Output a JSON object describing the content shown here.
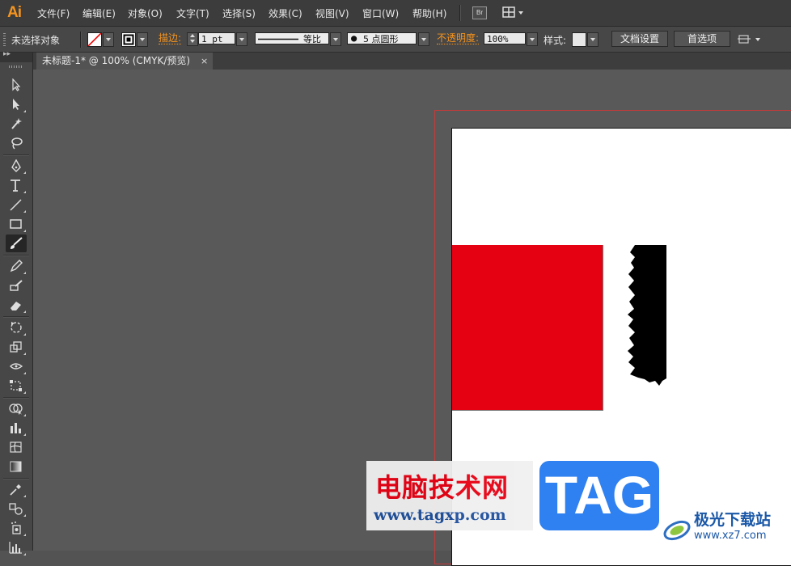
{
  "app": {
    "logo": "Ai"
  },
  "menu": [
    {
      "label": "文件(F)"
    },
    {
      "label": "编辑(E)"
    },
    {
      "label": "对象(O)"
    },
    {
      "label": "文字(T)"
    },
    {
      "label": "选择(S)"
    },
    {
      "label": "效果(C)"
    },
    {
      "label": "视图(V)"
    },
    {
      "label": "窗口(W)"
    },
    {
      "label": "帮助(H)"
    }
  ],
  "menubar": {
    "bridge_label": "Br"
  },
  "control": {
    "selection_status": "未选择对象",
    "stroke_label": "描边:",
    "stroke_weight": "1 pt",
    "profile_label": "等比",
    "brush_label": "5 点圆形",
    "opacity_label": "不透明度:",
    "opacity_value": "100%",
    "style_label": "样式:",
    "doc_setup_button": "文档设置",
    "prefs_button": "首选项"
  },
  "document": {
    "tab_title": "未标题-1* @ 100% (CMYK/预览)",
    "tab_close": "×"
  },
  "artwork": {
    "red_fill": "#e50012",
    "black_fill": "#000000"
  },
  "watermark": {
    "site_cn": "电脑技术网",
    "site_url": "www.tagxp.com",
    "tag": "TAG",
    "right_cn": "极光下载站",
    "right_url": "www.xz7.com"
  },
  "colors": {
    "accent": "#f7941d",
    "bleed": "#c43a3a"
  }
}
